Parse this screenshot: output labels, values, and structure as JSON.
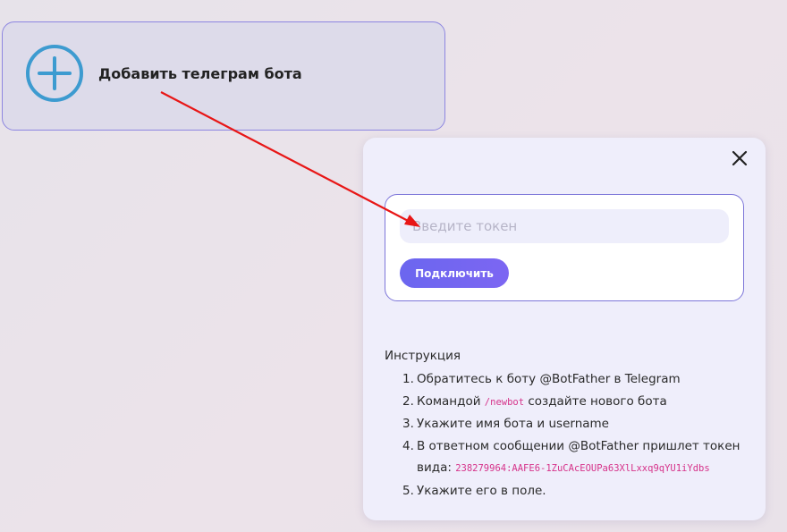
{
  "add_card": {
    "label": "Добавить телеграм бота",
    "icon": "plus-circle-icon",
    "accent": "#3d9bd0"
  },
  "modal": {
    "close_icon": "close-icon",
    "token_input": {
      "placeholder": "Введите токен",
      "value": ""
    },
    "connect_label": "Подключить",
    "instructions": {
      "title": "Инструкция",
      "steps": [
        {
          "num": "1.",
          "text": "Обратитесь к боту @BotFather в Telegram"
        },
        {
          "num": "2.",
          "pre": "Командой ",
          "code": "/newbot",
          "post": " создайте нового бота"
        },
        {
          "num": "3.",
          "text": "Укажите имя бота и username"
        },
        {
          "num": "4.",
          "pre": "В ответном сообщении @BotFather пришлет токен вида: ",
          "code": "238279964:AAFE6-1ZuCAcEOUPa63XlLxxq9qYU1iYdbs"
        },
        {
          "num": "5.",
          "text": "Укажите его в поле."
        }
      ]
    }
  },
  "colors": {
    "border": "#7d76d9",
    "button": "#6b66ef",
    "code": "#d6338a",
    "arrow": "#e81616"
  }
}
